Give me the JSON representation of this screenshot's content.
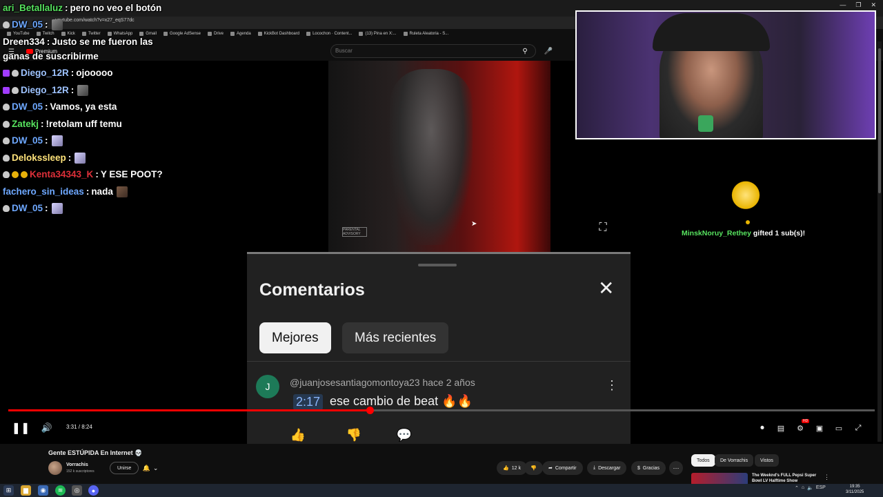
{
  "browser": {
    "url": "youtube.com/watch?v=x27_eqS77dc",
    "bookmarks": [
      "YouTube",
      "Twitch",
      "Kick",
      "Twitter",
      "WhatsApp",
      "Gmail",
      "Google AdSense",
      "Drive",
      "Agenda",
      "KickBot Dashboard",
      "Locochon · Content...",
      "(13) Pina en X:...",
      "Ruleta Aleatoria - S..."
    ]
  },
  "youtube": {
    "logo": "Premium",
    "search_placeholder": "Buscar",
    "explicit_label": "PARENTAL ADVISORY"
  },
  "comments": {
    "title": "Comentarios",
    "chips": [
      "Mejores",
      "Más recientes"
    ],
    "first": {
      "avatar_letter": "J",
      "author": "@juanjosesantiagomontoya23",
      "age": "hace 2 años",
      "timestamp": "2:17",
      "text": "ese cambio de beat 🔥🔥"
    }
  },
  "player": {
    "time": "3:31 / 8:24",
    "played_fraction": 0.417,
    "hd_badge": "HD"
  },
  "video": {
    "title": "Gente ESTÚPIDA En Internet 💀",
    "channel": "Vorrachis",
    "subscribers": "152 k suscriptores",
    "join_label": "Unirse",
    "likes": "12 k",
    "share_label": "Compartir",
    "download_label": "Descargar",
    "thanks_label": "Gracias"
  },
  "related": {
    "tabs": [
      "Todos",
      "De Vorrachis",
      "Vistos"
    ],
    "first_title": "The Weeknd's FULL Pepsi Super Bowl LV Halftime Show"
  },
  "taskbar": {
    "lang": "ESP",
    "time": "19:35",
    "date": "3/11/2025"
  },
  "chat": [
    {
      "user": "ari_Betallaluz",
      "color": "#57e35f",
      "message": "pero no veo el botón",
      "badges": []
    },
    {
      "user": "DW_05",
      "color": "#6ea8ff",
      "message": "",
      "badges": [
        "shield"
      ],
      "emote": "grey"
    },
    {
      "user": "Dreen334",
      "color": "#ffffff",
      "message": "Justo se me fueron las",
      "badges": []
    },
    {
      "user": "",
      "color": "#ffffff",
      "message": "ganas de suscribirme",
      "badges": []
    },
    {
      "user": "Diego_12R",
      "color": "#9ec3ff",
      "message": "ojooooo",
      "badges": [
        "hex",
        "shield"
      ]
    },
    {
      "user": "Diego_12R",
      "color": "#9ec3ff",
      "message": "",
      "badges": [
        "hex",
        "shield"
      ],
      "emote": "grey"
    },
    {
      "user": "DW_05",
      "color": "#6ea8ff",
      "message": "Vamos, ya esta",
      "badges": [
        "shield"
      ]
    },
    {
      "user": "Zatekj",
      "color": "#57e35f",
      "message": "!retolam uff temu",
      "badges": [
        "shield"
      ]
    },
    {
      "user": "DW_05",
      "color": "#6ea8ff",
      "message": "",
      "badges": [
        "shield"
      ],
      "emote": "purple"
    },
    {
      "user": "Delokssleep",
      "color": "#ffe37a",
      "message": "",
      "badges": [
        "shield"
      ],
      "emote": "purple"
    },
    {
      "user": "Kenta34343_K",
      "color": "#e0303a",
      "message": "Y ESE POOT?",
      "badges": [
        "shield",
        "gold",
        "gold"
      ]
    },
    {
      "user": "fachero_sin_ideas",
      "color": "#6ea8ff",
      "message": "nada",
      "badges": [],
      "emote": "brown"
    },
    {
      "user": "DW_05",
      "color": "#6ea8ff",
      "message": "",
      "badges": [
        "shield"
      ],
      "emote": "purple"
    }
  ],
  "alert": {
    "user": "MinskNoruy_Rethey",
    "message": "gifted 1 sub(s)!"
  }
}
